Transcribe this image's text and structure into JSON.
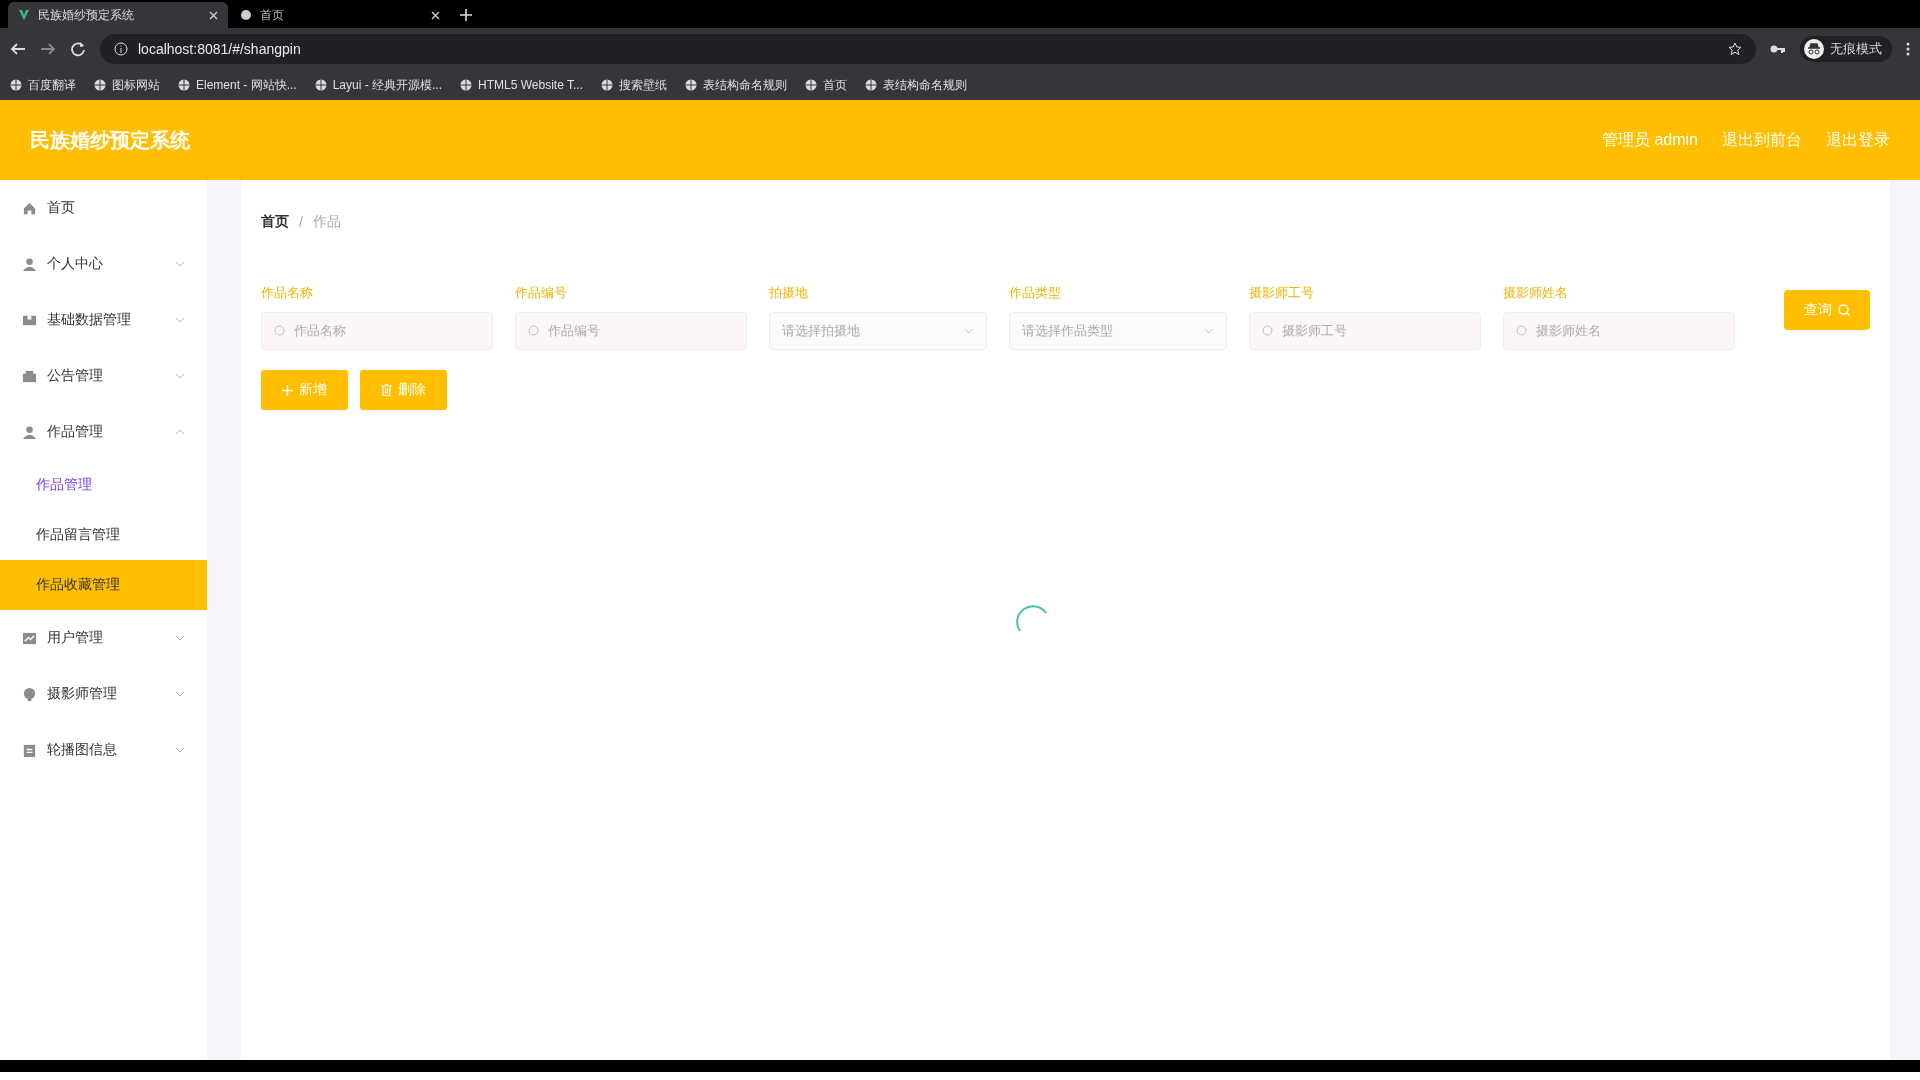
{
  "browser": {
    "tabs": [
      {
        "title": "民族婚纱预定系统",
        "selected": true
      },
      {
        "title": "首页",
        "selected": false
      }
    ],
    "address": "localhost:8081/#/shangpin",
    "profile_label": "无痕模式",
    "bookmarks": [
      "百度翻译",
      "图标网站",
      "Element - 网站快...",
      "Layui - 经典开源模...",
      "HTML5 Website T...",
      "搜索壁纸",
      "表结构命名规则",
      "首页",
      "表结构命名规则"
    ]
  },
  "header": {
    "title": "民族婚纱预定系统",
    "links": [
      "管理员 admin",
      "退出到前台",
      "退出登录"
    ]
  },
  "sidebar": {
    "items": [
      {
        "label": "首页",
        "kind": "link"
      },
      {
        "label": "个人中心",
        "kind": "group",
        "expanded": false
      },
      {
        "label": "基础数据管理",
        "kind": "group",
        "expanded": false
      },
      {
        "label": "公告管理",
        "kind": "group",
        "expanded": false
      },
      {
        "label": "作品管理",
        "kind": "group",
        "expanded": true,
        "children": [
          {
            "label": "作品管理",
            "selected": true,
            "hovered": false
          },
          {
            "label": "作品留言管理",
            "selected": false,
            "hovered": false
          },
          {
            "label": "作品收藏管理",
            "selected": false,
            "hovered": true
          }
        ]
      },
      {
        "label": "用户管理",
        "kind": "group",
        "expanded": false
      },
      {
        "label": "摄影师管理",
        "kind": "group",
        "expanded": false
      },
      {
        "label": "轮播图信息",
        "kind": "group",
        "expanded": false
      }
    ]
  },
  "breadcrumb": [
    "首页",
    "作品"
  ],
  "breadcrumb_separator": "/",
  "filters": [
    {
      "label": "作品名称",
      "kind": "search",
      "placeholder": "作品名称"
    },
    {
      "label": "作品编号",
      "kind": "search",
      "placeholder": "作品编号"
    },
    {
      "label": "拍摄地",
      "kind": "select",
      "placeholder": "请选择拍摄地"
    },
    {
      "label": "作品类型",
      "kind": "select",
      "placeholder": "请选择作品类型"
    },
    {
      "label": "摄影师工号",
      "kind": "search",
      "placeholder": "摄影师工号"
    },
    {
      "label": "摄影师姓名",
      "kind": "search",
      "placeholder": "摄影师姓名"
    }
  ],
  "query_button": "查询",
  "actions": [
    {
      "label": "新增",
      "kind": "add"
    },
    {
      "label": "删除",
      "kind": "delete"
    }
  ]
}
